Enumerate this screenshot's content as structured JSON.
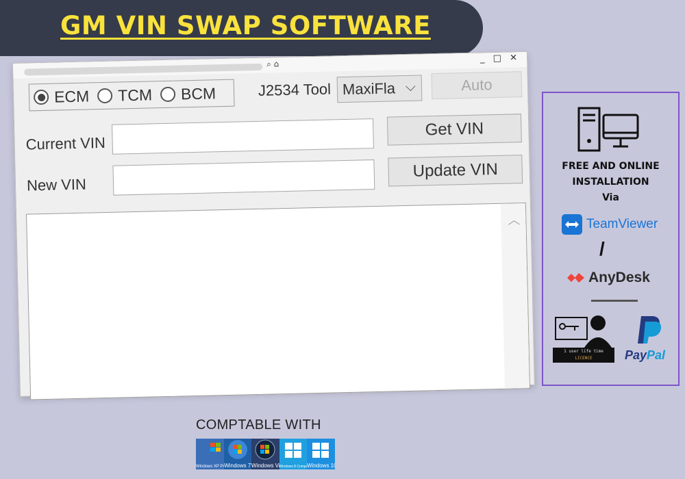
{
  "banner": {
    "title": "GM VIN SWAP SOFTWARE"
  },
  "window": {
    "titlebar_icons": "⌕ ⌂",
    "controls": {
      "minimize": "_",
      "maximize": "□",
      "close": "✕"
    },
    "modules": [
      {
        "label": "ECM",
        "checked": true
      },
      {
        "label": "TCM",
        "checked": false
      },
      {
        "label": "BCM",
        "checked": false
      }
    ],
    "tool_label": "J2534 Tool",
    "tool_selected": "MaxiFla",
    "auto_label": "Auto",
    "current_vin_label": "Current VIN",
    "current_vin_value": "",
    "new_vin_label": "New VIN",
    "new_vin_value": "",
    "get_vin_label": "Get VIN",
    "update_vin_label": "Update VIN",
    "log_text": ""
  },
  "info": {
    "line1": "FREE AND ONLINE",
    "line2": "INSTALLATION",
    "line3": "Via",
    "teamviewer": "TeamViewer",
    "separator": "/",
    "anydesk": "AnyDesk",
    "licence_line1": "1 user  life time",
    "licence_line2": "LICENCE",
    "paypal_1": "Pay",
    "paypal_2": "Pal"
  },
  "compat": {
    "label": "COMPTABLE WITH",
    "os": [
      {
        "name": "Windows XP Professional",
        "color": "#3a6fb8"
      },
      {
        "name": "Windows 7",
        "color": "#1f5fa6"
      },
      {
        "name": "Windows Vis",
        "color": "#2a3f6b"
      },
      {
        "name": "Windows 8 Compatible",
        "color": "#21a0e0"
      },
      {
        "name": "Windows 10",
        "color": "#1d8fe0"
      }
    ]
  }
}
